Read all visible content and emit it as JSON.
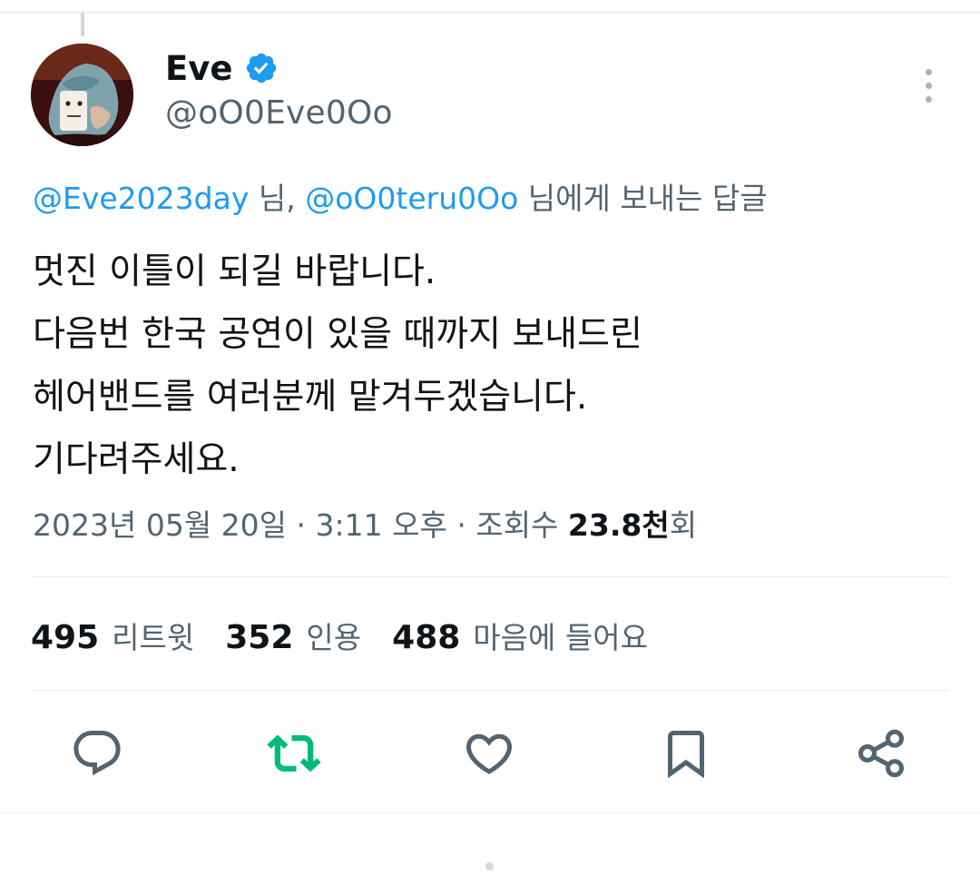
{
  "author": {
    "display_name": "Eve",
    "handle": "@oO0Eve0Oo",
    "verified": true
  },
  "reply_to": {
    "mention_1": "@Eve2023day",
    "sep_1": " 님, ",
    "mention_2": "@oO0teru0Oo",
    "suffix": " 님에게 보내는 답글"
  },
  "tweet": {
    "lines": [
      "멋진 이틀이 되길 바랍니다.",
      "다음번 한국 공연이 있을 때까지 보내드린",
      "헤어밴드를 여러분께 맡겨두겠습니다.",
      "기다려주세요."
    ]
  },
  "meta": {
    "date": "2023년 05월 20일",
    "dot_1": " · ",
    "time": "3:11 오후",
    "dot_2": " · ",
    "views_label": "조회수 ",
    "views_value": "23.8천",
    "views_suffix": "회"
  },
  "stats": {
    "retweets": {
      "value": "495",
      "label": "리트윗"
    },
    "quotes": {
      "value": "352",
      "label": "인용"
    },
    "likes": {
      "value": "488",
      "label": "마음에 들어요"
    }
  },
  "actions": {
    "reply": "speech-bubble-icon",
    "retweet": "retweet-icon",
    "like": "heart-icon",
    "bookmark": "bookmark-icon",
    "share": "share-icon"
  },
  "colors": {
    "accent": "#1d9bf0",
    "retweet_active": "#00ba7c",
    "secondary_text": "#536471",
    "icon": "#536471",
    "divider": "#e6ecf0"
  }
}
